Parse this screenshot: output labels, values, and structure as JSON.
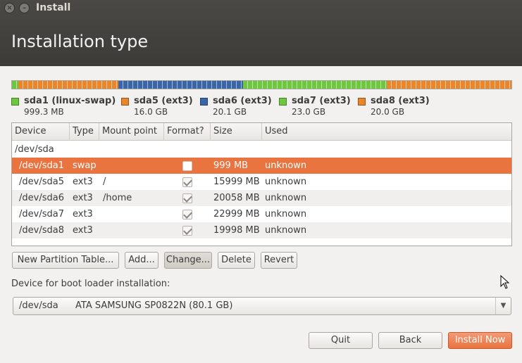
{
  "window": {
    "title": "Install",
    "close_glyph": "×",
    "min_glyph": "–"
  },
  "page": {
    "title": "Installation type"
  },
  "colors": {
    "green": "#6fc63f",
    "orange": "#e9852a",
    "blue": "#3a65a6",
    "selection": "#e9743f"
  },
  "partitions_bar": [
    {
      "name": "sda1",
      "fraction": 0.0125,
      "color": "#6fc63f"
    },
    {
      "name": "sda5",
      "fraction": 0.2,
      "color": "#e9852a"
    },
    {
      "name": "sda6",
      "fraction": 0.251,
      "color": "#3a65a6"
    },
    {
      "name": "sda7",
      "fraction": 0.2875,
      "color": "#6fc63f"
    },
    {
      "name": "sda8",
      "fraction": 0.25,
      "color": "#e9852a"
    }
  ],
  "legend": [
    {
      "name": "sda1 (linux-swap)",
      "size": "999.3 MB",
      "color": "#6fc63f"
    },
    {
      "name": "sda5 (ext3)",
      "size": "16.0 GB",
      "color": "#e9852a"
    },
    {
      "name": "sda6 (ext3)",
      "size": "20.1 GB",
      "color": "#3a65a6"
    },
    {
      "name": "sda7 (ext3)",
      "size": "23.0 GB",
      "color": "#6fc63f"
    },
    {
      "name": "sda8 (ext3)",
      "size": "20.0 GB",
      "color": "#e9852a"
    }
  ],
  "table": {
    "columns": [
      "Device",
      "Type",
      "Mount point",
      "Format?",
      "Size",
      "Used"
    ],
    "disk": "/dev/sda",
    "rows": [
      {
        "device": "/dev/sda1",
        "type": "swap",
        "mount": "",
        "format": false,
        "size": "999 MB",
        "used": "unknown",
        "selected": true
      },
      {
        "device": "/dev/sda5",
        "type": "ext3",
        "mount": "/",
        "format": true,
        "size": "15999 MB",
        "used": "unknown",
        "selected": false
      },
      {
        "device": "/dev/sda6",
        "type": "ext3",
        "mount": "/home",
        "format": true,
        "size": "20058 MB",
        "used": "unknown",
        "selected": false
      },
      {
        "device": "/dev/sda7",
        "type": "ext3",
        "mount": "",
        "format": true,
        "size": "22999 MB",
        "used": "unknown",
        "selected": false
      },
      {
        "device": "/dev/sda8",
        "type": "ext3",
        "mount": "",
        "format": true,
        "size": "19998 MB",
        "used": "unknown",
        "selected": false
      }
    ]
  },
  "actions": {
    "new_table": "New Partition Table...",
    "add": "Add...",
    "change": "Change...",
    "delete": "Delete",
    "revert": "Revert"
  },
  "boot_loader": {
    "label": "Device for boot loader installation:",
    "device": "/dev/sda",
    "description": "ATA SAMSUNG SP0822N (80.1 GB)",
    "arrow": "▼"
  },
  "footer": {
    "quit": "Quit",
    "back": "Back",
    "install": "Install Now"
  }
}
